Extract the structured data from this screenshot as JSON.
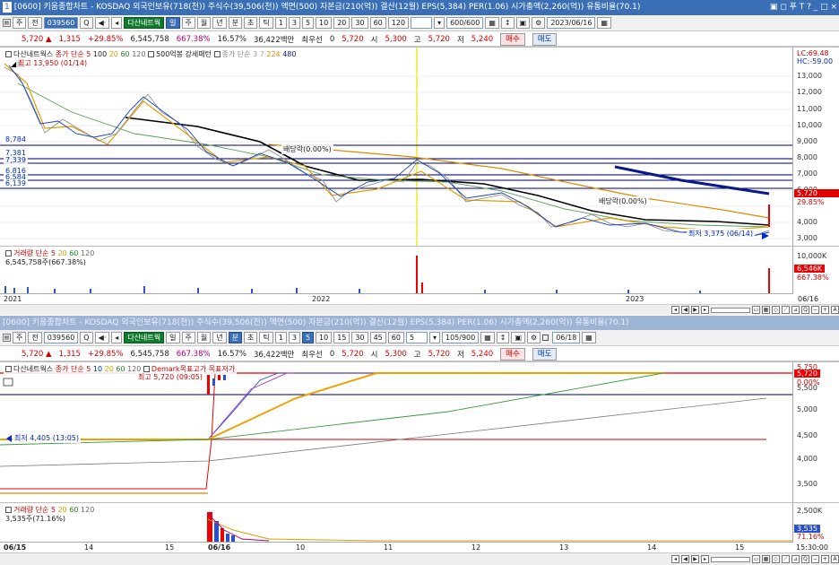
{
  "window": {
    "num": "1",
    "title": "[0600] 키움종합차트 - KOSDAQ 외국인보유(718(천)) 주식수(39,506(천)) 액면(500) 자본금(210(억)) 결산(12월) EPS(5,384) PER(1.06) 시가총액(2,260(억)) 유통비율(70.1)",
    "controls": "▣ ◻ 푸 T ?   _ □ ×"
  },
  "top": {
    "toolbar": {
      "period1": "주",
      "period2": "전",
      "code": "039560",
      "search": "Q",
      "stock_name": "다산네트웍",
      "tf": [
        "일",
        "주",
        "월",
        "년",
        "분",
        "초",
        "틱"
      ],
      "active_tf": "일",
      "nums": [
        "1",
        "3",
        "5",
        "10",
        "20",
        "30",
        "60",
        "120"
      ],
      "count": "600/600",
      "date": "2023/06/16"
    },
    "quote": {
      "price": "5,720",
      "arrow": "▲",
      "change": "1,315",
      "pct": "+29.85%",
      "volume": "6,545,758",
      "vol_pct": "667.38%",
      "turnover": "16.57%",
      "amount": "36,422백만",
      "pref": "최우선",
      "zero": "0",
      "last": "5,720",
      "open_l": "시",
      "open": "5,300",
      "high_l": "고",
      "high": "5,720",
      "low_l": "저",
      "low": "5,240",
      "buy": "매수",
      "sell": "매도"
    },
    "legend": {
      "name": "다산네트웍스",
      "ma": "종가 단순",
      "ma_vals": [
        "5",
        "100",
        "20",
        "60",
        "120"
      ],
      "pattern": "500억봉 강세패턴",
      "ma2": "종가 단순",
      "ma2_vals": [
        "3",
        "7",
        "224",
        "480"
      ]
    },
    "annotations": {
      "high": "최고 13,950 (01/14)",
      "div1": "배당락(0.00%)",
      "div2": "배당락(0.00%)",
      "low": "최저 3,375 (06/14)"
    },
    "right_info": {
      "lc": "LC:69.48",
      "hc": "HC:-59.00"
    },
    "yticks": [
      "13,000",
      "12,000",
      "11,000",
      "10,000",
      "9,000",
      "8,000",
      "7,000",
      "6,000",
      "5,000",
      "4,000",
      "3,000"
    ],
    "levels": [
      "8,784",
      "7,381",
      "7,339",
      "6,816",
      "6,584",
      "6,139"
    ],
    "price_box": {
      "p": "5,720",
      "pct": "29.85%"
    },
    "vol_legend": {
      "name": "거래량",
      "ma": "단순",
      "vals": [
        "5",
        "20",
        "60",
        "120"
      ],
      "val": "6,545,758주(667.38%)"
    },
    "vol_axis": {
      "max": "10,000K",
      "cur": "6,546K",
      "pct": "667.38%"
    },
    "dates": [
      "2021",
      "2022",
      "2023",
      "06/16"
    ]
  },
  "bottom": {
    "title": "[0600] 키움종합차트 - KOSDAQ 외국인보유(718(천)) 주식수(39,506(천)) 액면(500) 자본금(210(억)) 결산(12월) EPS(5,384) PER(1.06) 시가총액(2,260(억)) 유통비율(70.1)",
    "toolbar": {
      "period1": "주",
      "period2": "전",
      "code": "039560",
      "stock_name": "다산네트웍",
      "tf": [
        "일",
        "주",
        "월",
        "년",
        "분",
        "초",
        "틱"
      ],
      "active_tf": "분",
      "nums": [
        "1",
        "3",
        "5",
        "10",
        "15",
        "30",
        "45",
        "60"
      ],
      "active_num": "5",
      "count_sel": "5",
      "count": "105/900",
      "date": "06/18"
    },
    "legend": {
      "name": "다산네트웍스",
      "ma": "종가 단순",
      "ma_vals": [
        "5",
        "10",
        "20",
        "60",
        "120"
      ],
      "demark": "Demark목표고가",
      "demark2": "목표저가"
    },
    "annotations": {
      "high": "최고 5,720 (09:05)",
      "low": "최저 4,405 (13:05)"
    },
    "yticks": [
      "5,500",
      "5,000",
      "4,500",
      "4,000",
      "3,500"
    ],
    "right_info": [
      "5,750",
      "5,720",
      "0.00%"
    ],
    "vol_legend": {
      "name": "거래량",
      "ma": "단순",
      "vals": [
        "5",
        "20",
        "60",
        "120"
      ],
      "val": "3,535주(71.16%)"
    },
    "vol_axis": {
      "max": "2,500K",
      "cur": "3,535",
      "pct": "71.16%"
    },
    "dates": [
      "06/15",
      "14",
      "15",
      "06/16",
      "10",
      "11",
      "12",
      "13",
      "14",
      "15",
      "15:30:00"
    ]
  }
}
